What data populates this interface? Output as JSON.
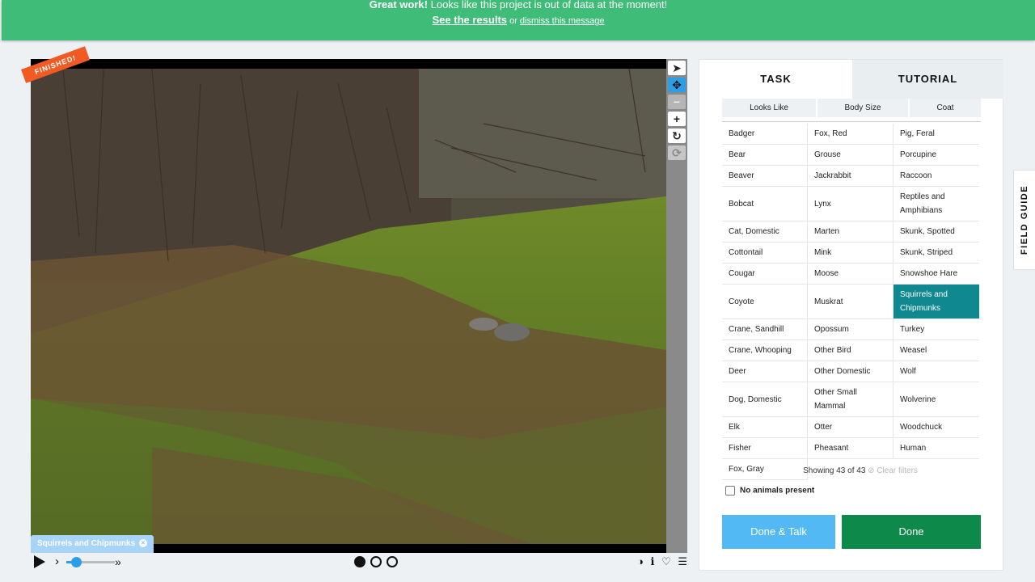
{
  "banner": {
    "headline_bold": "Great work!",
    "headline_rest": "Looks like this project is out of data at the moment!",
    "results_link": "See the results",
    "or_text": "or",
    "dismiss_link": "dismiss this message"
  },
  "viewer": {
    "status_ribbon": "FINISHED!",
    "selected_chip": "Squirrels and Chipmunks",
    "chip_remove_icon": "×",
    "tools": [
      {
        "name": "pointer-icon",
        "glyph": "➤"
      },
      {
        "name": "move-icon",
        "glyph": "✥"
      },
      {
        "name": "zoom-out-icon",
        "glyph": "−"
      },
      {
        "name": "zoom-in-icon",
        "glyph": "+"
      },
      {
        "name": "rotate-icon",
        "glyph": "↻"
      },
      {
        "name": "reset-icon",
        "glyph": "⟳"
      }
    ],
    "frames_total": 3,
    "current_frame": 1,
    "playback_speed_fraction": 0.2
  },
  "panel": {
    "tabs": {
      "task": "TASK",
      "tutorial": "TUTORIAL"
    },
    "filters": [
      "Looks Like",
      "Body Size",
      "Coat"
    ],
    "species": [
      "Badger",
      "Fox, Red",
      "Pig, Feral",
      "Bear",
      "Grouse",
      "Porcupine",
      "Beaver",
      "Jackrabbit",
      "Raccoon",
      "Bobcat",
      "Lynx",
      "Reptiles and Amphibians",
      "Cat, Domestic",
      "Marten",
      "Skunk, Spotted",
      "Cottontail",
      "Mink",
      "Skunk, Striped",
      "Cougar",
      "Moose",
      "Snowshoe Hare",
      "Coyote",
      "Muskrat",
      "Squirrels and Chipmunks",
      "Crane, Sandhill",
      "Opossum",
      "Turkey",
      "Crane, Whooping",
      "Other Bird",
      "Weasel",
      "Deer",
      "Other Domestic",
      "Wolf",
      "Dog, Domestic",
      "Other Small Mammal",
      "Wolverine",
      "Elk",
      "Otter",
      "Woodchuck",
      "Fisher",
      "Pheasant",
      "Human",
      "Fox, Gray"
    ],
    "selected_species": "Squirrels and Chipmunks",
    "showing_text": "Showing 43 of 43",
    "clear_filters": "Clear filters",
    "no_animals_label": "No animals present",
    "done_talk_label": "Done & Talk",
    "done_label": "Done",
    "colors": {
      "selected": "#10888f",
      "done": "#0d894a",
      "done_talk": "#52b9f5",
      "banner": "#3fbc78"
    }
  },
  "field_guide_label": "FIELD GUIDE"
}
